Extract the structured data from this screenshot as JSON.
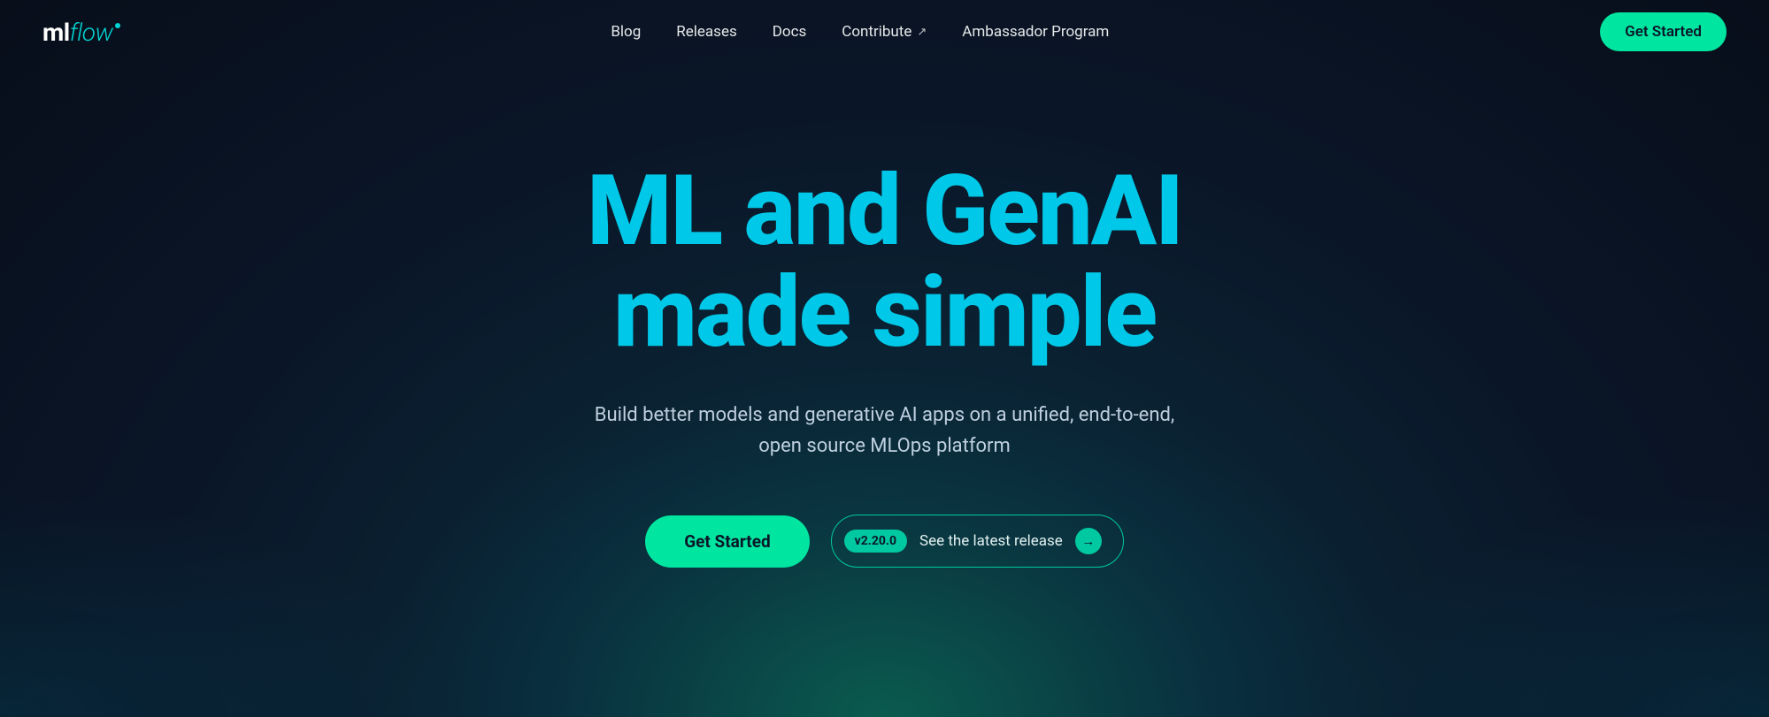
{
  "brand": {
    "ml": "ml",
    "flow": "flow"
  },
  "nav": {
    "links": [
      {
        "id": "blog",
        "label": "Blog"
      },
      {
        "id": "releases",
        "label": "Releases"
      },
      {
        "id": "docs",
        "label": "Docs"
      },
      {
        "id": "contribute",
        "label": "Contribute",
        "external": true
      },
      {
        "id": "ambassador",
        "label": "Ambassador Program"
      }
    ],
    "cta_label": "Get Started"
  },
  "hero": {
    "title_line1": "ML and GenAI",
    "title_line2": "made simple",
    "subtitle_line1": "Build better models and generative AI apps on a unified, end-to-end,",
    "subtitle_line2": "open source MLOps platform",
    "cta_button": "Get Started",
    "version_badge": "v2.20.0",
    "release_text": "See the latest release",
    "arrow": "→"
  },
  "colors": {
    "accent_cyan": "#00c8e8",
    "accent_green": "#00e5a0",
    "accent_teal": "#00c8a0",
    "bg_dark": "#0a1628"
  }
}
